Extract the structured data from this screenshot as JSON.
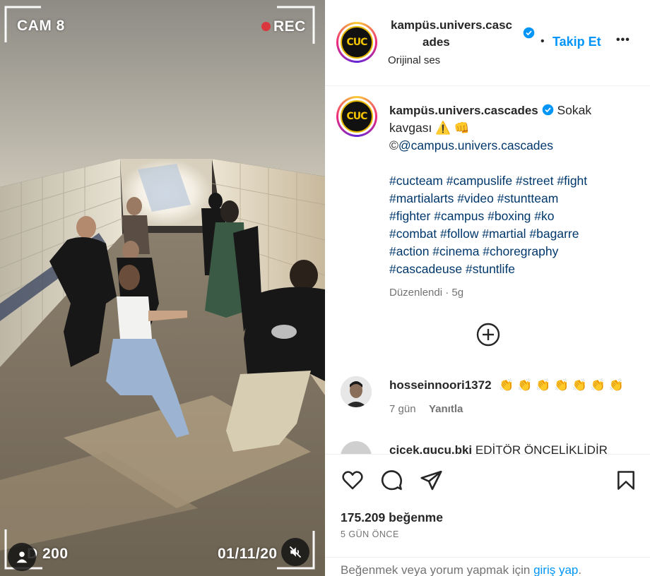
{
  "media": {
    "cam_label": "CAM 8",
    "rec_label": "REC",
    "bottom_left_label": "D 200",
    "bottom_right_label": "01/11/20",
    "colors": {
      "rec_dot": "#d9363e"
    },
    "icons": {
      "user": "user-icon",
      "mute": "speaker-muted-icon"
    }
  },
  "header": {
    "username_line1": "kampüs.univers.casc",
    "username_line2": "ades",
    "follow_label": "Takip Et",
    "separator": "•",
    "audio_label": "Orijinal ses",
    "more_label": "•••",
    "avatar_text": "CUC"
  },
  "caption": {
    "username": "kampüs.univers.cascades",
    "text_line1": "Sokak",
    "text_line2": "kavgası ⚠️ 👊",
    "copyright_prefix": "©",
    "mention": "@campus.univers.cascades",
    "hashtag_lines": [
      "#cucteam #campuslife #street #fight",
      "#martialarts #video #stuntteam",
      "#fighter #campus #boxing #ko",
      "#combat #follow #martial #bagarre",
      "#action #cinema #choregraphy",
      "#cascadeuse #stuntlife"
    ],
    "meta": "Düzenlendi · 5g"
  },
  "comments": [
    {
      "username": "hosseinnoori1372",
      "text": "👏 👏 👏 👏 👏 👏 👏",
      "time": "7 gün",
      "reply_label": "Yanıtla"
    },
    {
      "username": "cicek.gucu.bki",
      "text": "EDİTÖR ÖNCELİKLİDİR"
    }
  ],
  "actions": {
    "icons": [
      "heart-icon",
      "comment-icon",
      "share-icon",
      "bookmark-icon"
    ],
    "likes": "175.209 beğenme",
    "time_ago": "5 GÜN ÖNCE",
    "login_prefix": "Beğenmek veya yorum yapmak için ",
    "login_link": "giriş yap",
    "login_suffix": "."
  },
  "colors": {
    "accent": "#0095f6",
    "hashtag": "#00376b",
    "muted": "#737373",
    "verified": "#0095f6"
  }
}
